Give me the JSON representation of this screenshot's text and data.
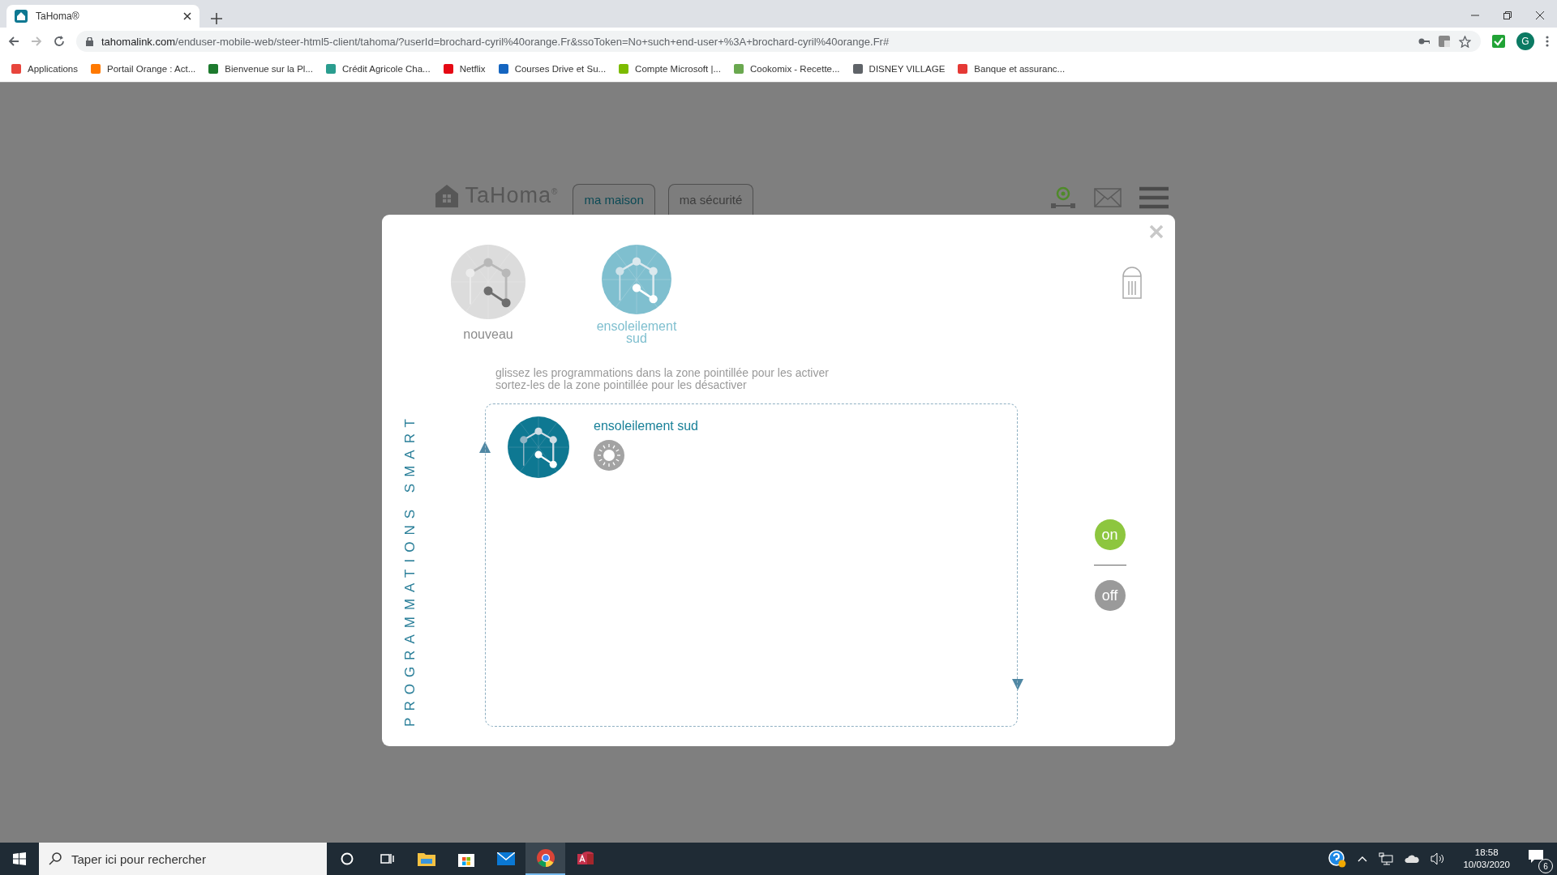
{
  "browser": {
    "tab_title": "TaHoma®",
    "url_host": "tahomalink.com",
    "url_path": "/enduser-mobile-web/steer-html5-client/tahoma/?userId=brochard-cyril%40orange.Fr&ssoToken=No+such+end-user+%3A+brochard-cyril%40orange.Fr#",
    "profile_initial": "G",
    "bookmarks": [
      {
        "label": "Applications",
        "color": "#e8453c"
      },
      {
        "label": "Portail Orange : Act...",
        "color": "#ff7900"
      },
      {
        "label": "Bienvenue sur la Pl...",
        "color": "#1d7a2e"
      },
      {
        "label": "Crédit Agricole Cha...",
        "color": "#2a9d8f"
      },
      {
        "label": "Netflix",
        "color": "#e50914"
      },
      {
        "label": "Courses Drive et Su...",
        "color": "#1565c0"
      },
      {
        "label": "Compte Microsoft |...",
        "color": "#7cbb00"
      },
      {
        "label": "Cookomix - Recette...",
        "color": "#6aa84f"
      },
      {
        "label": "DISNEY VILLAGE",
        "color": "#5f6368"
      },
      {
        "label": "Banque et assuranc...",
        "color": "#e53935"
      }
    ]
  },
  "header": {
    "logo": "TaHoma$^{®}$",
    "tabs": [
      {
        "label": "ma maison",
        "selected": true
      },
      {
        "label": "ma sécurité",
        "selected": false
      }
    ]
  },
  "dialog": {
    "scenes": [
      {
        "label": "nouveau",
        "selected": false
      },
      {
        "label": "ensoleilement sud",
        "selected": true
      }
    ],
    "instructions": [
      "glissez les programmations dans la zone pointillée pour les activer",
      "sortez-les de la zone pointillée pour les désactiver"
    ],
    "side_label": "PROGRAMMATIONS SMART",
    "active_programs": [
      {
        "title": "ensoleilement sud"
      }
    ],
    "switches": [
      {
        "label": "on",
        "selected": true
      },
      {
        "label": "off",
        "selected": false
      }
    ]
  },
  "taskbar": {
    "search_placeholder": "Taper ici pour rechercher",
    "time": "18:58",
    "date": "10/03/2020",
    "notifications": "6"
  }
}
